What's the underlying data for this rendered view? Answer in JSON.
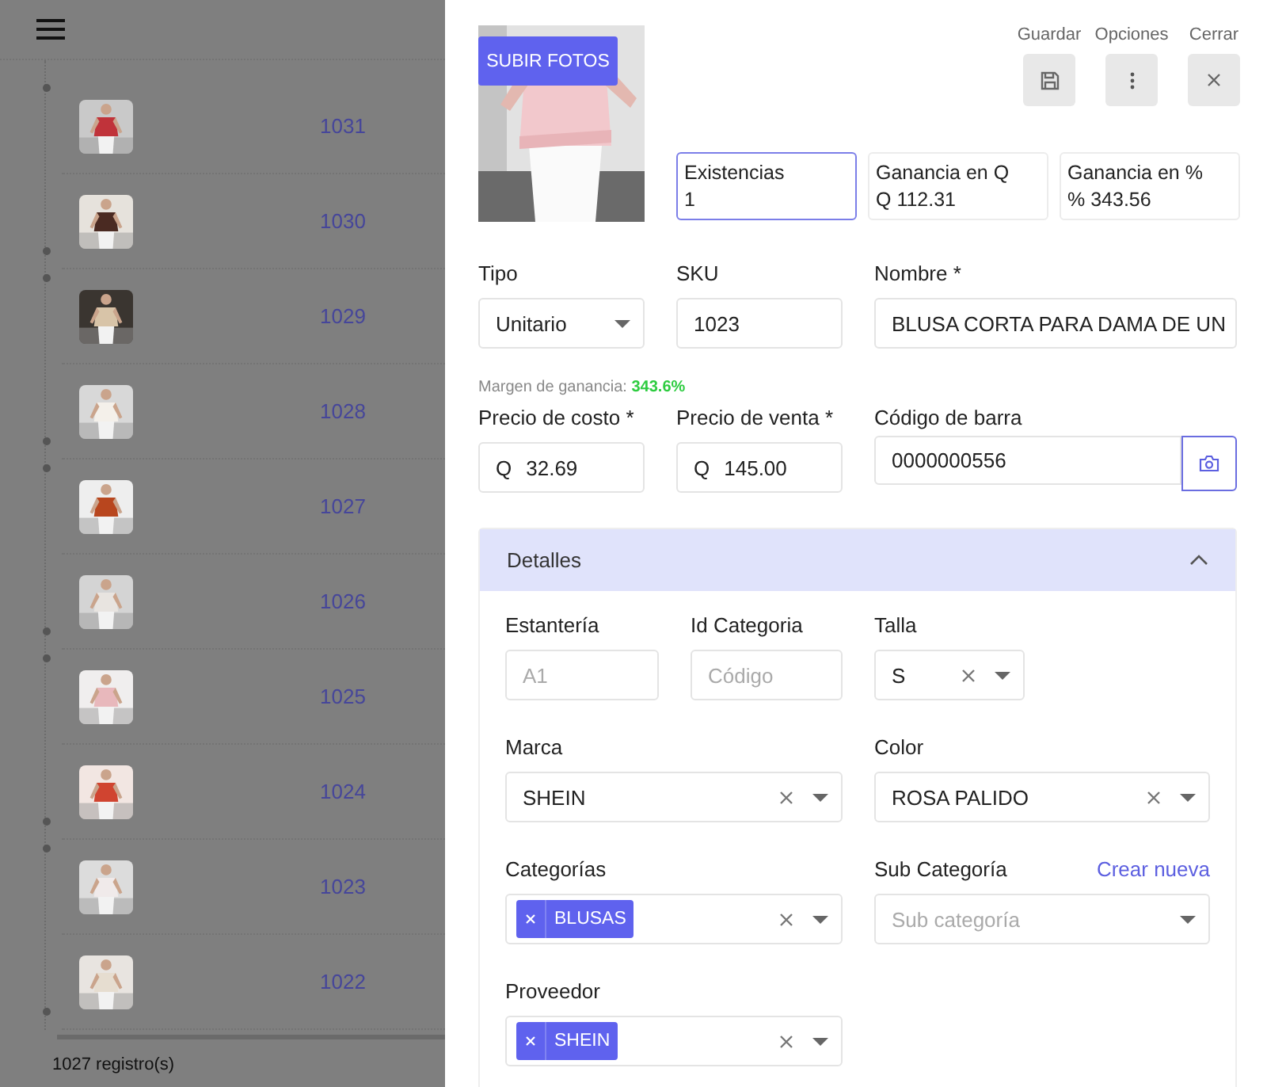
{
  "list": {
    "rows": [
      {
        "number": "1031"
      },
      {
        "number": "1030"
      },
      {
        "number": "1029"
      },
      {
        "number": "1028"
      },
      {
        "number": "1027"
      },
      {
        "number": "1026"
      },
      {
        "number": "1025"
      },
      {
        "number": "1024"
      },
      {
        "number": "1023"
      },
      {
        "number": "1022"
      }
    ],
    "footer": "1027 registro(s)"
  },
  "drawer": {
    "upload_button": "SUBIR FOTOS",
    "actions": [
      {
        "label": "Guardar"
      },
      {
        "label": "Opciones"
      },
      {
        "label": "Cerrar"
      }
    ],
    "stats": [
      {
        "label": "Existencias",
        "value": "1",
        "focused": true
      },
      {
        "label": "Ganancia en Q",
        "value": "Q 112.31",
        "focused": false
      },
      {
        "label": "Ganancia en %",
        "value": "% 343.56",
        "focused": false
      }
    ],
    "fields": [
      {
        "label": "Tipo",
        "kind": "select",
        "value": "Unitario",
        "clearable": false
      },
      {
        "label": "SKU",
        "kind": "input",
        "value": "1023"
      },
      {
        "label": "Nombre *",
        "kind": "input",
        "value": "BLUSA CORTA PARA DAMA DE UN"
      }
    ],
    "margin": {
      "label": "Margen de ganancia:",
      "value": "343.6%"
    },
    "price_fields": [
      {
        "label": "Precio de costo *",
        "kind": "input",
        "prefix": "Q",
        "value": "32.69"
      },
      {
        "label": "Precio de venta *",
        "kind": "input",
        "prefix": "Q",
        "value": "145.00"
      },
      {
        "label": "Código de barra",
        "kind": "scan",
        "value": "0000000556"
      }
    ],
    "details": {
      "title": "Detalles",
      "expanded": true,
      "rows": [
        [
          {
            "label": "Estantería",
            "kind": "input",
            "placeholder": "A1"
          },
          {
            "label": "Id Categoria",
            "kind": "input",
            "placeholder": "Código"
          },
          {
            "label": "Talla",
            "kind": "select",
            "value": "S",
            "clearable": true
          }
        ],
        [
          {
            "label": "Marca",
            "kind": "select",
            "value": "SHEIN",
            "clearable": true
          },
          {
            "label": "Color",
            "kind": "select",
            "value": "ROSA PALIDO",
            "clearable": true
          }
        ],
        [
          {
            "label": "Categorías",
            "kind": "tags",
            "tags": [
              "BLUSAS"
            ],
            "clearable": true
          },
          {
            "label": "Sub Categoría",
            "kind": "select",
            "placeholder": "Sub categoría",
            "clearable": false,
            "link": "Crear nueva"
          }
        ],
        [
          {
            "label": "Proveedor",
            "kind": "tags",
            "tags": [
              "SHEIN"
            ],
            "clearable": true
          }
        ]
      ]
    }
  }
}
